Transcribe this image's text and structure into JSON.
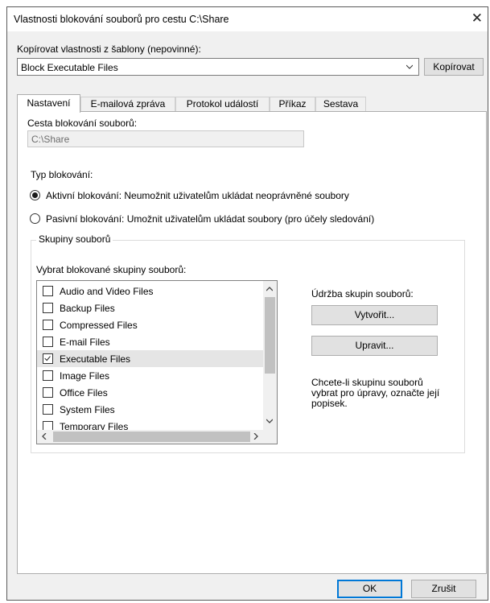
{
  "window": {
    "title": "Vlastnosti blokování souborů pro cestu C:\\Share"
  },
  "template": {
    "label": "Kopírovat vlastnosti z šablony (nepovinné):",
    "selected": "Block Executable Files",
    "copy_button": "Kopírovat"
  },
  "tabs": [
    {
      "label": "Nastavení",
      "active": true
    },
    {
      "label": "E-mailová zpráva",
      "active": false
    },
    {
      "label": "Protokol událostí",
      "active": false
    },
    {
      "label": "Příkaz",
      "active": false
    },
    {
      "label": "Sestava",
      "active": false
    }
  ],
  "settings": {
    "path_label": "Cesta blokování souborů:",
    "path_value": "C:\\Share",
    "type_label": "Typ blokování:",
    "active_option": "Aktivní blokování: Neumožnit uživatelům ukládat neoprávněné soubory",
    "passive_option": "Pasivní blokování: Umožnit uživatelům ukládat soubory (pro účely sledování)",
    "selected_type": "active"
  },
  "file_groups": {
    "group_label": "Skupiny souborů",
    "list_label": "Vybrat blokované skupiny souborů:",
    "items": [
      {
        "label": "Audio and Video Files",
        "checked": false
      },
      {
        "label": "Backup Files",
        "checked": false
      },
      {
        "label": "Compressed Files",
        "checked": false
      },
      {
        "label": "E-mail Files",
        "checked": false
      },
      {
        "label": "Executable Files",
        "checked": true
      },
      {
        "label": "Image Files",
        "checked": false
      },
      {
        "label": "Office Files",
        "checked": false
      },
      {
        "label": "System Files",
        "checked": false
      },
      {
        "label": "Temporary Files",
        "checked": false
      }
    ],
    "maintenance_label": "Údržba skupin souborů:",
    "create_button": "Vytvořit...",
    "edit_button": "Upravit...",
    "hint": "Chcete-li skupinu souborů vybrat pro úpravy, označte její popisek."
  },
  "footer": {
    "ok_button": "OK",
    "cancel_button": "Zrušit"
  },
  "colors": {
    "accent": "#0078d7",
    "dialog_bg": "#f0f0f0",
    "selection": "#e5e5e5"
  }
}
